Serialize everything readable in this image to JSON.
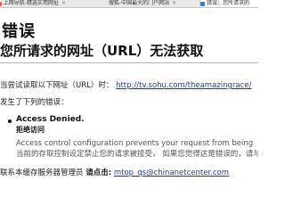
{
  "tabs": [
    {
      "label": "上网导航-精选实用网址",
      "favicon_color": "#e8554a",
      "close": "×",
      "active": false
    },
    {
      "label": "搜狐-中国最大的门户网站",
      "favicon_color": "#f2b23a",
      "close": "×",
      "active": false
    },
    {
      "label": "错误：您所请求的",
      "favicon_color": "#3a7bd5",
      "close": "",
      "active": true
    }
  ],
  "error": {
    "title": "错误",
    "subtitle": "您所请求的网址（URL）无法获取",
    "attempt_prefix": "当尝试读取以下网址（URL）时：",
    "url": "http://tv.sohu.com/theamazingrace/",
    "encountered": "发生了下列的错误：",
    "access_denied": "Access Denied.",
    "access_denied_cn": "拒绝访问",
    "detail_en": "Access control configuration prevents your request from being",
    "detail_cn": "当前的存取控制设定禁止您的请求被接受， 如果您觉得这是错误的，请与",
    "contact_prefix": "联系本缓存服务器管理员",
    "contact_bold": "请点击:",
    "contact_email": "mtop_qs@chinanetcenter.com"
  }
}
